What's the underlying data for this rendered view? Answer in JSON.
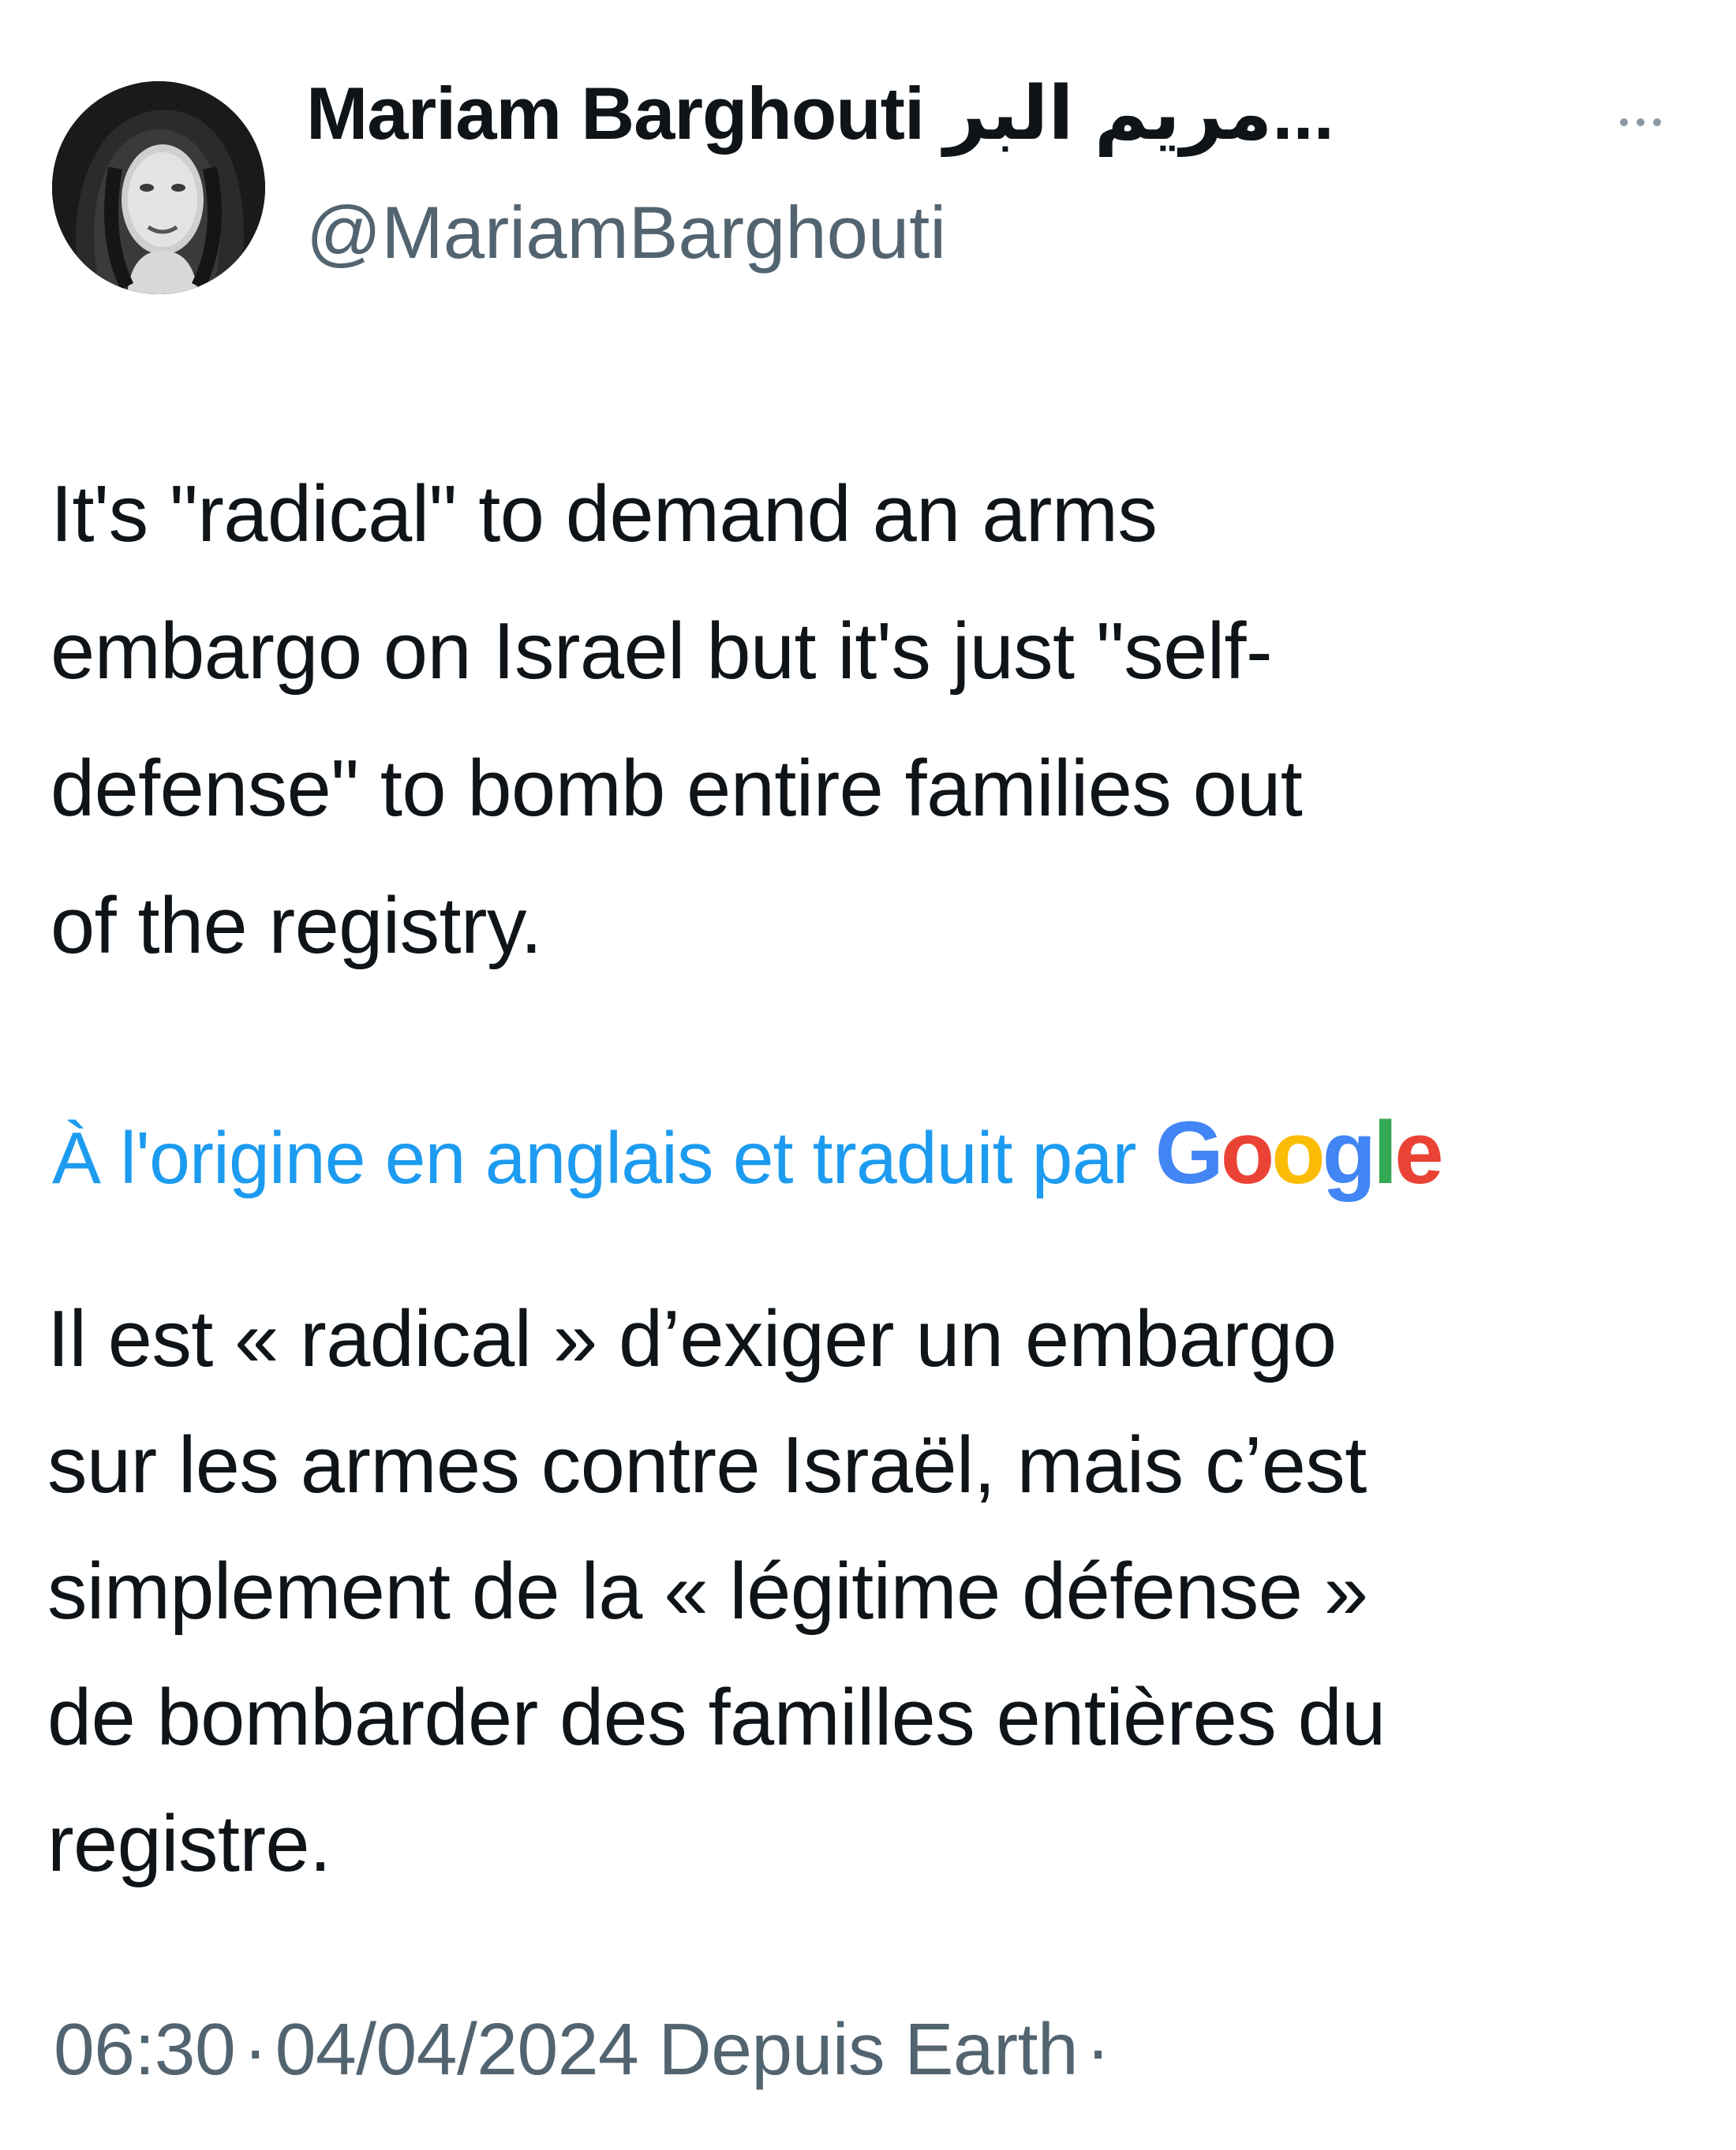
{
  "author": {
    "display_name": "Mariam Barghouti مريم البر...",
    "handle": "@MariamBarghouti"
  },
  "tweet": {
    "text_lines": [
      "It's \"radical\" to demand an arms",
      "embargo on Israel but it's just \"self-",
      "defense\" to bomb entire families out",
      "of the registry."
    ],
    "translation_label": "À l'origine en anglais et traduit par",
    "translation_provider": {
      "letters": [
        "G",
        "o",
        "o",
        "g",
        "l",
        "e"
      ],
      "colors": [
        "#4285F4",
        "#EA4335",
        "#FBBC05",
        "#4285F4",
        "#34A853",
        "#EA4335"
      ]
    },
    "translated_lines": [
      "Il est « radical » d’exiger un embargo",
      "sur les armes contre Israël, mais c’est",
      "simplement de la « légitime défense »",
      "de bombarder des familles entières du",
      "registre."
    ]
  },
  "meta": {
    "time": "06:30",
    "separator": "·",
    "date": "04/04/2024",
    "source": "Depuis Earth",
    "trailing_separator": "·"
  },
  "colors": {
    "text": "#0f1419",
    "secondary": "#536471",
    "link": "#1d9bf0"
  },
  "icons": {
    "more": "more-horizontal-icon"
  }
}
